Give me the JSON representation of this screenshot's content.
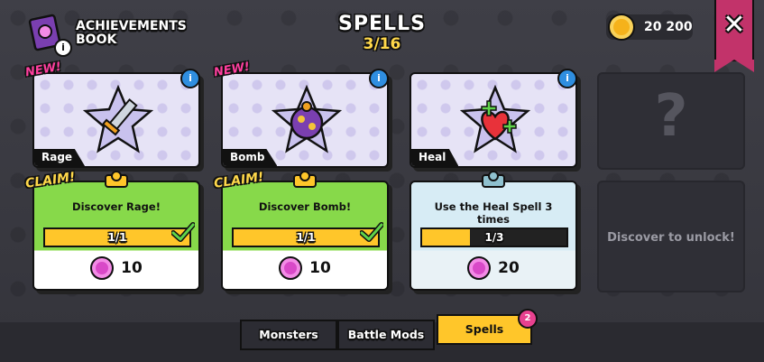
{
  "header": {
    "book_label_line1": "ACHIEVEMENTS",
    "book_label_line2": "BOOK",
    "info_badge": "i",
    "title": "SPELLS",
    "progress": "3/16",
    "coins": "20 200",
    "close": "✕"
  },
  "cards": [
    {
      "name": "Rage",
      "new": "NEW!",
      "info": "i",
      "claim": "CLAIM!",
      "quest": "Discover Rage!",
      "bar": "1/1",
      "progress": 1.0,
      "reward": "10",
      "state": "done"
    },
    {
      "name": "Bomb",
      "new": "NEW!",
      "info": "i",
      "claim": "CLAIM!",
      "quest": "Discover Bomb!",
      "bar": "1/1",
      "progress": 1.0,
      "reward": "10",
      "state": "done"
    },
    {
      "name": "Heal",
      "info": "i",
      "quest": "Use the Heal Spell 3 times",
      "bar": "1/3",
      "progress": 0.333,
      "reward": "20",
      "state": "pending"
    }
  ],
  "locked": {
    "symbol": "?",
    "text": "Discover to unlock!"
  },
  "tabs": [
    {
      "label": "Monsters"
    },
    {
      "label": "Battle Mods"
    },
    {
      "label": "Spells",
      "badge": "2",
      "active": true
    }
  ],
  "colors": {
    "accent": "#ffc62a",
    "claim_green": "#87d94a",
    "gem": "#d949c8",
    "new_pink": "#ff3f9f",
    "close_ribbon": "#c2336a"
  }
}
